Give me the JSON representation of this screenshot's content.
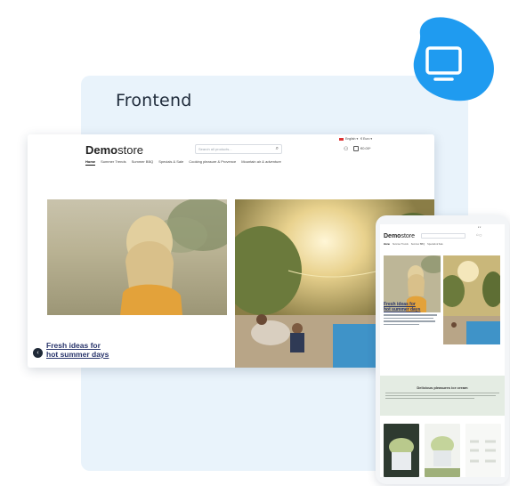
{
  "panel": {
    "title": "Frontend"
  },
  "badge": {
    "icon": "monitor-icon",
    "color": "#1f9bf0"
  },
  "desktop": {
    "logo_bold": "Demo",
    "logo_light": "store",
    "search_placeholder": "Search all products...",
    "language": "English",
    "currency": "€ Euro",
    "cart_total": "€0.00*",
    "nav": [
      "Home",
      "Summer Trends",
      "Summer BBQ",
      "Specials & Sale",
      "Cooking pleasure & Provence",
      "Mountain air & adventure"
    ],
    "teaser_line1": "Fresh ideas for",
    "teaser_line2": "hot summer days"
  },
  "mobile": {
    "logo_bold": "Demo",
    "logo_light": "store",
    "teaser_line1": "Fresh ideas for",
    "teaser_line2": "hot summer days",
    "section_title": "Delicious pleasures ice cream"
  },
  "colors": {
    "accent": "#1f9bf0",
    "panel": "#e9f3fb",
    "teaser": "#28346b"
  }
}
